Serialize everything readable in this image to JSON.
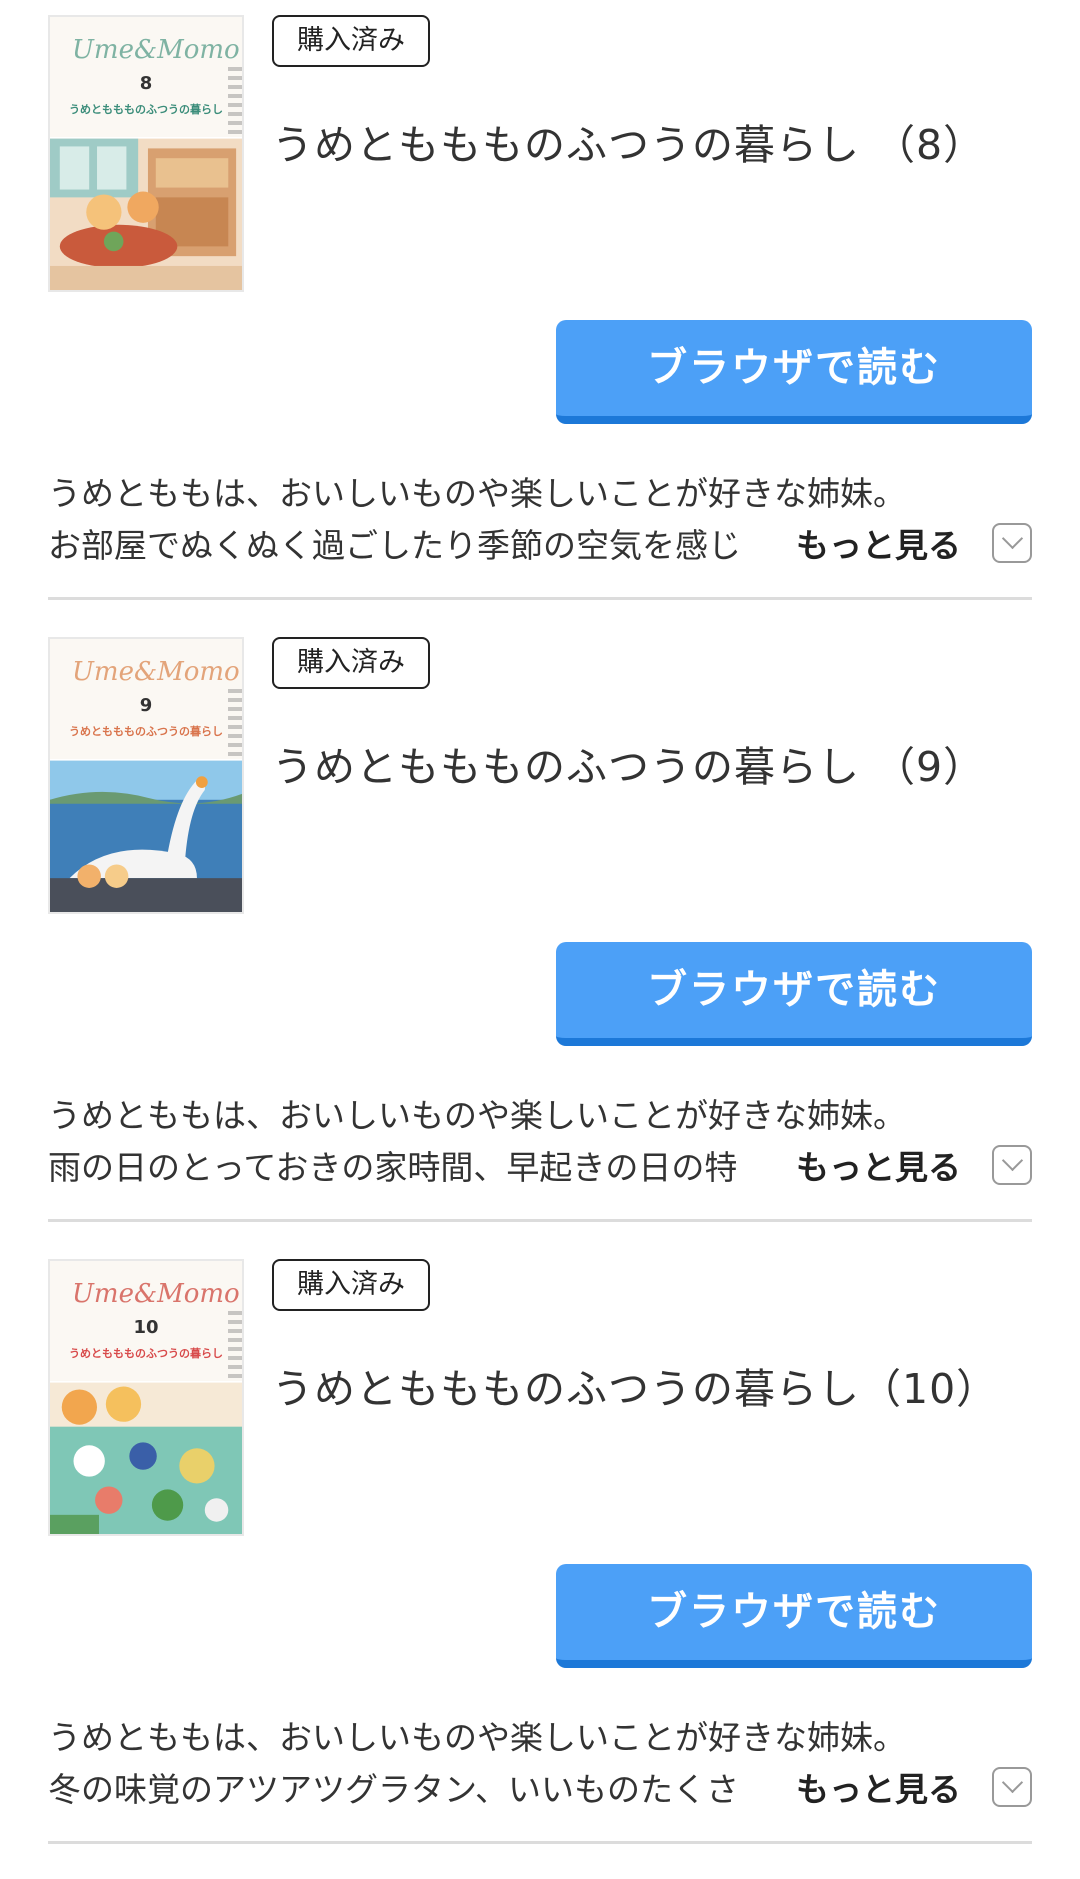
{
  "items": [
    {
      "badge": "購入済み",
      "title": "うめとももものふつうの暮らし （8）",
      "cover_logo": "Ume&Momo",
      "cover_volume": "8",
      "cover_title": "うめとももものふつうの暮らし",
      "read_button": "ブラウザで読む",
      "desc_line1": "うめとももは、おいしいものや楽しいことが好きな姉妹。",
      "desc_line2": "お部屋でぬくぬく過ごしたり季節の空気を感じ",
      "more_label": "もっと見る"
    },
    {
      "badge": "購入済み",
      "title": "うめとももものふつうの暮らし （9）",
      "cover_logo": "Ume&Momo",
      "cover_volume": "9",
      "cover_title": "うめとももものふつうの暮らし",
      "read_button": "ブラウザで読む",
      "desc_line1": "うめとももは、おいしいものや楽しいことが好きな姉妹。",
      "desc_line2": "雨の日のとっておきの家時間、早起きの日の特",
      "more_label": "もっと見る"
    },
    {
      "badge": "購入済み",
      "title": "うめとももものふつうの暮らし（10）",
      "cover_logo": "Ume&Momo",
      "cover_volume": "10",
      "cover_title": "うめとももものふつうの暮らし",
      "read_button": "ブラウザで読む",
      "desc_line1": "うめとももは、おいしいものや楽しいことが好きな姉妹。",
      "desc_line2": "冬の味覚のアツアツグラタン、いいものたくさ",
      "more_label": "もっと見る"
    }
  ],
  "colors": {
    "button": "#4ca0f7",
    "button_shadow": "#1c78d8",
    "divider": "#dcdcdc",
    "cover_logo": "#7fb3a3"
  }
}
